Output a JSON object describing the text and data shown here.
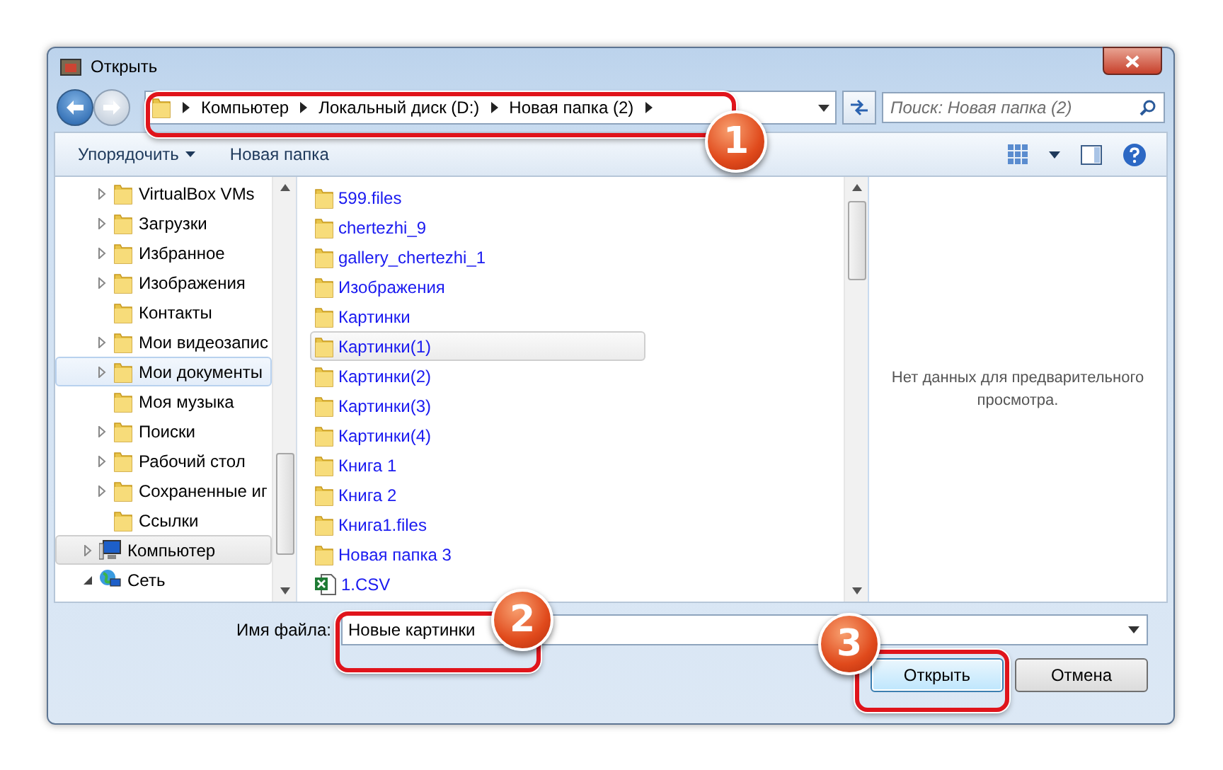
{
  "window": {
    "title": "Открыть"
  },
  "address": {
    "crumbs": [
      "Компьютер",
      "Локальный диск (D:)",
      "Новая папка (2)"
    ],
    "search_placeholder": "Поиск: Новая папка (2)"
  },
  "toolbar": {
    "organize": "Упорядочить",
    "new_folder": "Новая папка"
  },
  "sidebar": {
    "folders": [
      {
        "label": "VirtualBox VMs",
        "expandable": true,
        "selected": false
      },
      {
        "label": "Загрузки",
        "expandable": true,
        "selected": false
      },
      {
        "label": "Избранное",
        "expandable": true,
        "selected": false
      },
      {
        "label": "Изображения",
        "expandable": true,
        "selected": false
      },
      {
        "label": "Контакты",
        "expandable": false,
        "selected": false
      },
      {
        "label": "Мои видеозапис",
        "expandable": true,
        "selected": false
      },
      {
        "label": "Мои документы",
        "expandable": true,
        "selected": true
      },
      {
        "label": "Моя музыка",
        "expandable": false,
        "selected": false
      },
      {
        "label": "Поиски",
        "expandable": true,
        "selected": false
      },
      {
        "label": "Рабочий стол",
        "expandable": true,
        "selected": false
      },
      {
        "label": "Сохраненные иг",
        "expandable": true,
        "selected": false
      },
      {
        "label": "Ссылки",
        "expandable": false,
        "selected": false
      }
    ],
    "roots": [
      {
        "label": "Компьютер",
        "kind": "computer",
        "expanded": false,
        "selected": true
      },
      {
        "label": "Сеть",
        "kind": "network",
        "expanded": true,
        "selected": false
      }
    ]
  },
  "files": [
    {
      "name": "599.files",
      "kind": "folder",
      "selected": false
    },
    {
      "name": "chertezhi_9",
      "kind": "folder",
      "selected": false
    },
    {
      "name": "gallery_chertezhi_1",
      "kind": "folder",
      "selected": false
    },
    {
      "name": "Изображения",
      "kind": "folder",
      "selected": false
    },
    {
      "name": "Картинки",
      "kind": "folder",
      "selected": false
    },
    {
      "name": "Картинки(1)",
      "kind": "folder",
      "selected": true
    },
    {
      "name": "Картинки(2)",
      "kind": "folder",
      "selected": false
    },
    {
      "name": "Картинки(3)",
      "kind": "folder",
      "selected": false
    },
    {
      "name": "Картинки(4)",
      "kind": "folder",
      "selected": false
    },
    {
      "name": "Книга 1",
      "kind": "folder",
      "selected": false
    },
    {
      "name": "Книга 2",
      "kind": "folder",
      "selected": false
    },
    {
      "name": "Книга1.files",
      "kind": "folder",
      "selected": false
    },
    {
      "name": "Новая папка 3",
      "kind": "folder",
      "selected": false
    },
    {
      "name": "1.CSV",
      "kind": "csv",
      "selected": false
    }
  ],
  "preview": {
    "message": "Нет данных для предварительного просмотра."
  },
  "filename": {
    "label": "Имя файла:",
    "value": "Новые картинки"
  },
  "buttons": [
    {
      "label": "Открыть",
      "default": true
    },
    {
      "label": "Отмена",
      "default": false
    }
  ],
  "callouts": [
    {
      "number": "1"
    },
    {
      "number": "2"
    },
    {
      "number": "3"
    }
  ]
}
